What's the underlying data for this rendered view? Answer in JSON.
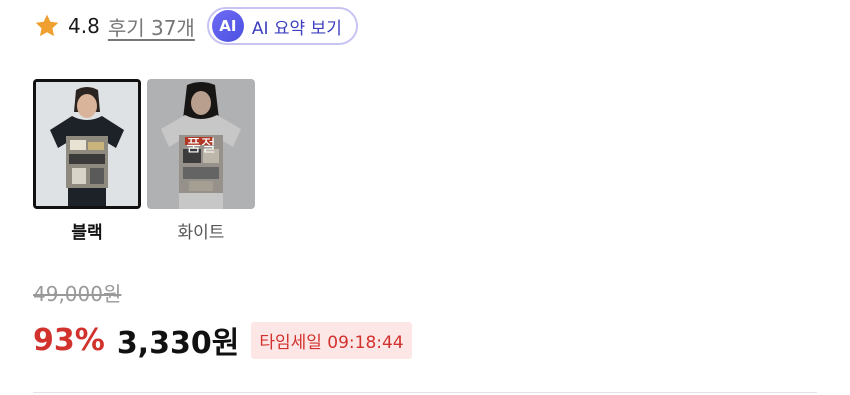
{
  "rating": {
    "value": "4.8",
    "review_link": "후기 37개"
  },
  "ai_summary": {
    "badge": "AI",
    "label": "AI 요약 보기"
  },
  "colors": {
    "star": "#f0a030",
    "accent_red": "#d2322d",
    "ai_purple": "#4b4fe0",
    "time_sale_bg": "#fde6e6"
  },
  "options": [
    {
      "label": "블랙",
      "selected": true,
      "sold_out": false,
      "image_icon": "black-tshirt-photo"
    },
    {
      "label": "화이트",
      "selected": false,
      "sold_out": true,
      "overlay_text": "품절",
      "image_icon": "white-tshirt-photo"
    }
  ],
  "price": {
    "original": "49,000원",
    "discount": "93%",
    "sale": "3,330원",
    "time_sale": "타임세일 09:18:44"
  }
}
